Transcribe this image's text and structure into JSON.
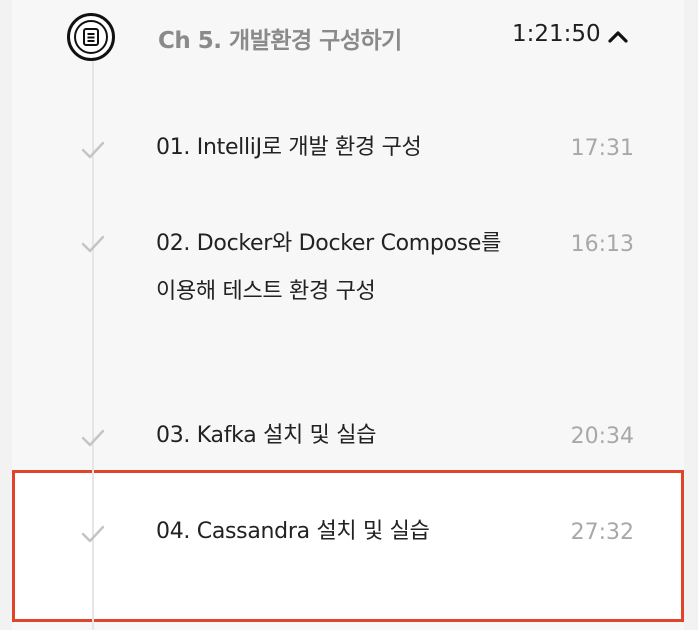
{
  "chapter": {
    "title": "Ch 5. 개발환경 구성하기",
    "duration": "1:21:50",
    "icon": "document-list-icon",
    "toggle_icon": "chevron-up-icon"
  },
  "lessons": [
    {
      "title": "01. IntelliJ로 개발 환경 구성",
      "time": "17:31",
      "completed_icon": "check-icon"
    },
    {
      "title": "02. Docker와 Docker Compose를 이용해 테스트 환경 구성",
      "time": "16:13",
      "completed_icon": "check-icon"
    },
    {
      "title": "03. Kafka 설치 및 실습",
      "time": "20:34",
      "completed_icon": "check-icon"
    },
    {
      "title": "04. Cassandra 설치 및 실습",
      "time": "27:32",
      "completed_icon": "check-icon",
      "highlighted": true
    }
  ],
  "colors": {
    "highlight_border": "#e0442a",
    "check": "#c4c4c4",
    "time": "#a8a8a8"
  }
}
